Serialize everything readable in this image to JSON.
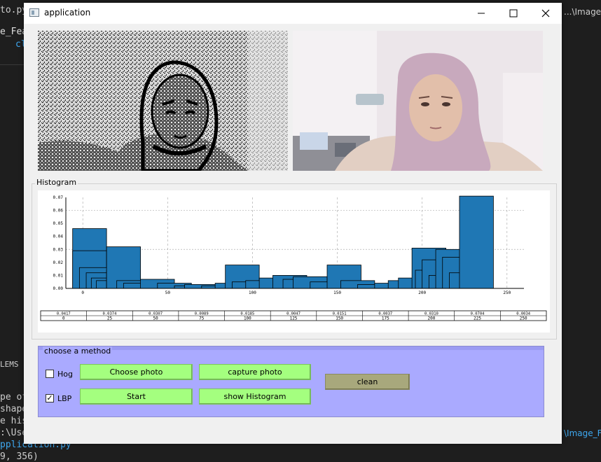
{
  "background_editor": {
    "tab_left": "to.py",
    "line_left_1": "e_Feat",
    "line_left_2": "cl",
    "panel_tab": "LEMS",
    "terminal_lines": [
      "pe of",
      "shape",
      "e hist",
      ":\\Use",
      "pplication.py",
      "9, 356)"
    ],
    "right_path_top": "...\\Image_F",
    "right_path_bottom": "\\Image_Fe"
  },
  "window": {
    "title": "application",
    "controls": {
      "minimize": "—",
      "maximize": "☐",
      "close": "✕"
    }
  },
  "images": {
    "left": "lbp-filtered-face",
    "right": "webcam-photo"
  },
  "histogram": {
    "group_title": "Histogram"
  },
  "chart_data": {
    "type": "bar",
    "title": "",
    "xlabel": "",
    "ylabel": "",
    "xlim": [
      -10,
      260
    ],
    "ylim": [
      0,
      0.07
    ],
    "x_ticks": [
      "0",
      "50",
      "100",
      "150",
      "200",
      "250"
    ],
    "y_ticks": [
      "0.00",
      "0.01",
      "0.02",
      "0.03",
      "0.04",
      "0.05",
      "0.06",
      "0.07"
    ],
    "grid": true,
    "bars": [
      {
        "x0": -6,
        "x1": 14,
        "value": 0.046
      },
      {
        "x0": -6,
        "x1": 14,
        "value": 0.029
      },
      {
        "x0": -2,
        "x1": 18,
        "value": 0.016
      },
      {
        "x0": 2,
        "x1": 22,
        "value": 0.012
      },
      {
        "x0": 5,
        "x1": 25,
        "value": 0.008
      },
      {
        "x0": 8,
        "x1": 28,
        "value": 0.006
      },
      {
        "x0": 14,
        "x1": 34,
        "value": 0.014
      },
      {
        "x0": 14,
        "x1": 34,
        "value": 0.032
      },
      {
        "x0": 20,
        "x1": 40,
        "value": 0.006
      },
      {
        "x0": 24,
        "x1": 44,
        "value": 0.004
      },
      {
        "x0": 34,
        "x1": 54,
        "value": 0.007
      },
      {
        "x0": 44,
        "x1": 64,
        "value": 0.004
      },
      {
        "x0": 54,
        "x1": 74,
        "value": 0.002
      },
      {
        "x0": 60,
        "x1": 80,
        "value": 0.003
      },
      {
        "x0": 70,
        "x1": 90,
        "value": 0.002
      },
      {
        "x0": 78,
        "x1": 98,
        "value": 0.004
      },
      {
        "x0": 84,
        "x1": 104,
        "value": 0.018
      },
      {
        "x0": 88,
        "x1": 108,
        "value": 0.005
      },
      {
        "x0": 96,
        "x1": 116,
        "value": 0.006
      },
      {
        "x0": 104,
        "x1": 124,
        "value": 0.008
      },
      {
        "x0": 112,
        "x1": 132,
        "value": 0.01
      },
      {
        "x0": 118,
        "x1": 138,
        "value": 0.007
      },
      {
        "x0": 124,
        "x1": 144,
        "value": 0.009
      },
      {
        "x0": 134,
        "x1": 154,
        "value": 0.005
      },
      {
        "x0": 144,
        "x1": 164,
        "value": 0.018
      },
      {
        "x0": 152,
        "x1": 172,
        "value": 0.006
      },
      {
        "x0": 162,
        "x1": 182,
        "value": 0.003
      },
      {
        "x0": 172,
        "x1": 192,
        "value": 0.004
      },
      {
        "x0": 180,
        "x1": 200,
        "value": 0.006
      },
      {
        "x0": 186,
        "x1": 206,
        "value": 0.008
      },
      {
        "x0": 194,
        "x1": 214,
        "value": 0.031
      },
      {
        "x0": 196,
        "x1": 216,
        "value": 0.014
      },
      {
        "x0": 200,
        "x1": 220,
        "value": 0.022
      },
      {
        "x0": 204,
        "x1": 224,
        "value": 0.01
      },
      {
        "x0": 208,
        "x1": 228,
        "value": 0.03
      },
      {
        "x0": 212,
        "x1": 232,
        "value": 0.024
      },
      {
        "x0": 216,
        "x1": 236,
        "value": 0.012
      },
      {
        "x0": 222,
        "x1": 242,
        "value": 0.071
      }
    ]
  },
  "table": {
    "values": [
      "0.0417",
      "0.0374",
      "0.0307",
      "0.0089",
      "0.0185",
      "0.0047",
      "0.0151",
      "0.0037",
      "0.0310",
      "0.0704",
      "0.0034"
    ],
    "keys": [
      "0",
      "25",
      "50",
      "75",
      "100",
      "125",
      "150",
      "175",
      "200",
      "225",
      "250"
    ]
  },
  "method": {
    "group_title": "choose a method",
    "hog_label": "Hog",
    "hog_checked": "",
    "lbp_label": "LBP",
    "lbp_checked": "✓",
    "choose_photo": "Choose photo",
    "capture_photo": "capture photo",
    "start": "Start",
    "show_histogram": "show Histogram",
    "clean": "clean"
  },
  "colors": {
    "bar_fill": "#1f77b4",
    "method_bg": "#aaaaff",
    "green_button": "#a4ff7f",
    "clean_button": "#a8a87c"
  }
}
